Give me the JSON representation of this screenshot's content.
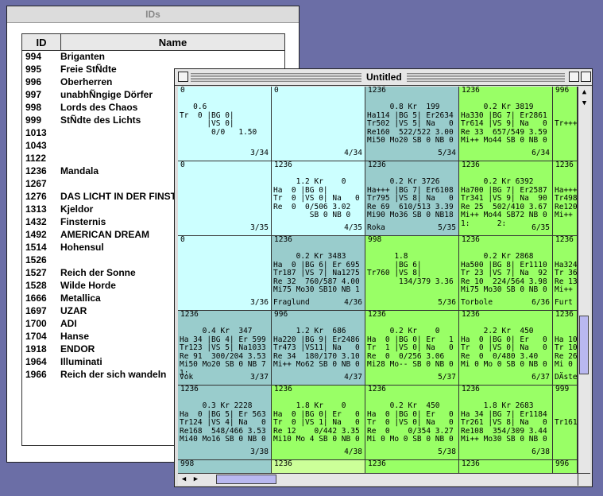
{
  "ids_window": {
    "title": "IDs",
    "col_id": "ID",
    "col_name": "Name",
    "rows": [
      {
        "id": "994",
        "name": "Briganten"
      },
      {
        "id": "995",
        "name": "Freie StÑdte"
      },
      {
        "id": "996",
        "name": "Oberherren"
      },
      {
        "id": "997",
        "name": "unabhÑngige Dörfer"
      },
      {
        "id": "998",
        "name": "Lords des Chaos"
      },
      {
        "id": "999",
        "name": "StÑdte des Lichts"
      },
      {
        "id": "1013",
        "name": ""
      },
      {
        "id": "1043",
        "name": ""
      },
      {
        "id": "1122",
        "name": ""
      },
      {
        "id": "1236",
        "name": "Mandala"
      },
      {
        "id": "1267",
        "name": ""
      },
      {
        "id": "1276",
        "name": "DAS LICHT IN DER FINSTE"
      },
      {
        "id": "1313",
        "name": "Kjeldor"
      },
      {
        "id": "1432",
        "name": "Finsternis"
      },
      {
        "id": "1492",
        "name": "AMERICAN DREAM"
      },
      {
        "id": "1514",
        "name": "Hohensul"
      },
      {
        "id": "1526",
        "name": ""
      },
      {
        "id": "1527",
        "name": "Reich der Sonne"
      },
      {
        "id": "1528",
        "name": "Wilde Horde"
      },
      {
        "id": "1666",
        "name": "Metallica"
      },
      {
        "id": "1697",
        "name": "UZAR"
      },
      {
        "id": "1700",
        "name": "ADI"
      },
      {
        "id": "1704",
        "name": "Hanse"
      },
      {
        "id": "1918",
        "name": "ENDOR"
      },
      {
        "id": "1964",
        "name": "Illuminati"
      },
      {
        "id": "1966",
        "name": "Reich der sich wandeln"
      }
    ]
  },
  "main_window": {
    "title": "Untitled",
    "colors": {
      "cyan": "#ccffff",
      "teal": "#99cccc",
      "green": "#99ff66",
      "lightgreen": "#ccff99",
      "white": "#ffffff"
    },
    "rows": [
      [
        {
          "color": "cyan",
          "top": "0",
          "body": "   0.6\nTr  0 |BG 0|\n      |VS 0|\n       0/0   1.50",
          "br": "3/34",
          "bl": ""
        },
        {
          "color": "cyan",
          "top": "0",
          "body": "",
          "br": "4/34",
          "bl": ""
        },
        {
          "color": "teal",
          "top": "1236",
          "body": "     0.8 Kr  199\nHa114 |BG 5| Er2634\nTr502 |VS 5| Na   0\nRe160  522/522 3.00\nMi50 Mo20 SB 0 NB 0",
          "br": "5/34",
          "bl": ""
        },
        {
          "color": "green",
          "top": "1236",
          "body": "     0.2 Kr 3819\nHa330 |BG 7| Er2861\nTr614 |VS 9| Na   0\nRe 33  657/549 3.59\nMi++ Mo44 SB 0 NB 0",
          "br": "6/34",
          "bl": ""
        },
        {
          "color": "green",
          "top": "996",
          "body": "\n\nTr+++",
          "br": "",
          "bl": ""
        }
      ],
      [
        {
          "color": "cyan",
          "top": "0",
          "body": "",
          "br": "3/35",
          "bl": ""
        },
        {
          "color": "cyan",
          "top": "1236",
          "body": "     1.2 Kr    0\nHa  0 |BG 0|\nTr  0 |VS 0| Na   0\nRe  0  0/506 3.02\n        SB 0 NB 0",
          "br": "4/35",
          "bl": ""
        },
        {
          "color": "teal",
          "top": "1236",
          "body": "     0.2 Kr 3726\nHa+++ |BG 7| Er6108\nTr795 |VS 8| Na   0\nRe 69  610/513 3.39\nMi90 Mo36 SB 0 NB18",
          "br": "5/35",
          "bl": "Roka"
        },
        {
          "color": "green",
          "top": "1236",
          "body": "     0.2 Kr 6392\nHa700 |BG 7| Er2587\nTr341 |VS 9| Na  90\nRe 25  502/410 3.67\nMi++ Mo44 SB72 NB 0\n1:      2:",
          "br": "6/35",
          "bl": ""
        },
        {
          "color": "green",
          "top": "1236",
          "body": "\nHa+++\nTr498\nRe120\nMi++",
          "br": "",
          "bl": ""
        }
      ],
      [
        {
          "color": "cyan",
          "top": "0",
          "body": "",
          "br": "3/36",
          "bl": ""
        },
        {
          "color": "teal",
          "top": "1236",
          "body": "     0.2 Kr 3483\nHa  0 |BG 6| Er 695\nTr187 |VS 7| Na1275\nRe 32  760/587 4.00\nMi75 Mo30 SB10 NB 1",
          "br": "4/36",
          "bl": "Fraglund"
        },
        {
          "color": "green",
          "top": "998",
          "body": "      1.8\n      |BG 6|\nTr760 |VS 8|\n       134/379 3.36",
          "br": "5/36",
          "bl": ""
        },
        {
          "color": "green",
          "top": "1236",
          "body": "     0.2 Kr 2868\nHa500 |BG 8| Er1110\nTr 23 |VS 7| Na  92\nRe 10  224/564 3.98\nMi75 Mo30 SB 0 NB 0",
          "br": "6/36",
          "bl": "Torbole"
        },
        {
          "color": "green",
          "top": "1236",
          "body": "\nHa324\nTr 36\nRe 13\nMi++",
          "br": "",
          "bl": "Furt"
        }
      ],
      [
        {
          "color": "teal",
          "top": "1236",
          "body": "     0.4 Kr  347\nHa 34 |BG 4| Er 599\nTr123 |VS 5| Na1033\nRe 91  300/204 3.53\nMi50 Mo20 SB 0 NB 7\n1:",
          "br": "3/37",
          "bl": "Vok"
        },
        {
          "color": "teal",
          "top": "996",
          "body": "     1.2 Kr  686\nHa220 |BG 9| Er2486\nTr473 |VS11| Na   0\nRe 34  180/170 3.10\nMi++ Mo62 SB 0 NB 0",
          "br": "4/37",
          "bl": ""
        },
        {
          "color": "green",
          "top": "1236",
          "body": "     0.2 Kr    0\nHa  0 |BG 0| Er   1\nTr  1 |VS 0| Na   0\nRe  0  0/256 3.06\nMi28 Mo-- SB 0 NB 0",
          "br": "5/37",
          "bl": ""
        },
        {
          "color": "green",
          "top": "1236",
          "body": "     2.2 Kr  450\nHa  0 |BG 0| Er   0\nTr  0 |VS 0| Na   0\nRe  0  0/480 3.40\nMi 0 Mo 0 SB 0 NB 0",
          "br": "6/37",
          "bl": ""
        },
        {
          "color": "green",
          "top": "1236",
          "body": "\nHa 10\nTr 10\nRe 26\nMi 0",
          "br": "",
          "bl": "DÄste"
        }
      ],
      [
        {
          "color": "teal",
          "top": "1236",
          "body": "     0.3 Kr 2228\nHa  0 |BG 5| Er 563\nTr124 |VS 4| Na   0\nRe168  548/466 3.53\nMi40 Mo16 SB 0 NB 0",
          "br": "3/38",
          "bl": ""
        },
        {
          "color": "green",
          "top": "1236",
          "body": "     1.8 Kr    0\nHa  0 |BG 0| Er   0\nTr  0 |VS 1| Na   0\nRe 12    0/442 3.35\nMi10 Mo 4 SB 0 NB 0",
          "br": "4/38",
          "bl": ""
        },
        {
          "color": "green",
          "top": "1236",
          "body": "     0.2 Kr  450\nHa  0 |BG 0| Er   0\nTr  0 |VS 0| Na   0\nRe  0    0/354 3.27\nMi 0 Mo 0 SB 0 NB 0",
          "br": "5/38",
          "bl": ""
        },
        {
          "color": "green",
          "top": "1236",
          "body": "     1.8 Kr 2683\nHa 34 |BG 7| Er1184\nTr261 |VS 8| Na   0\nRe108  354/309 3.44\nMi++ Mo30 SB 0 NB 0",
          "br": "6/38",
          "bl": ""
        },
        {
          "color": "green",
          "top": "999",
          "body": "\n\nTr161",
          "br": "",
          "bl": ""
        }
      ],
      [
        {
          "color": "teal",
          "top": "998",
          "body": "",
          "br": "",
          "bl": ""
        },
        {
          "color": "lightgreen",
          "top": "1236",
          "body": "",
          "br": "",
          "bl": ""
        },
        {
          "color": "green",
          "top": "1236",
          "body": "",
          "br": "",
          "bl": ""
        },
        {
          "color": "green",
          "top": "1236",
          "body": "",
          "br": "",
          "bl": ""
        },
        {
          "color": "green",
          "top": "996",
          "body": "",
          "br": "",
          "bl": ""
        }
      ]
    ]
  }
}
